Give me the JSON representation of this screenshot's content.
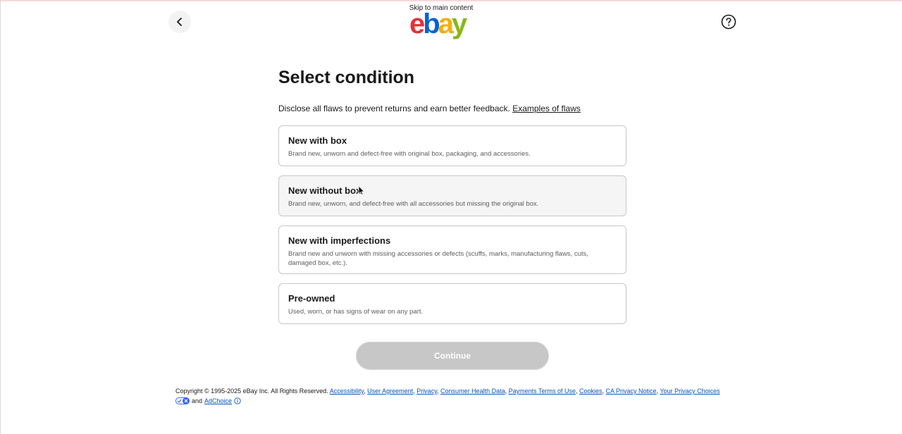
{
  "header": {
    "skip_link": "Skip to main content",
    "logo": {
      "e": "e",
      "b": "b",
      "a": "a",
      "y": "y"
    },
    "colors": {
      "e": "#e53238",
      "b": "#0064d2",
      "a": "#f5af02",
      "y": "#86b817"
    },
    "back_icon": "chevron-left-icon",
    "help_icon": "question-circle-icon"
  },
  "main": {
    "title": "Select condition",
    "subtitle": "Disclose all flaws to prevent returns and earn better feedback.",
    "examples_link": "Examples of flaws",
    "options": [
      {
        "title": "New with box",
        "desc": "Brand new, unworn and defect-free with original box, packaging, and accessories."
      },
      {
        "title": "New without box",
        "desc": "Brand new, unworn, and defect-free with all accessories but missing the original box."
      },
      {
        "title": "New with imperfections",
        "desc": "Brand new and unworn with missing accessories or defects (scuffs, marks, manufacturing flaws, cuts, damaged box, etc.)."
      },
      {
        "title": "Pre-owned",
        "desc": "Used, worn, or has signs of wear on any part."
      }
    ],
    "continue_label": "Continue"
  },
  "footer": {
    "copyright": "Copyright © 1995-2025 eBay Inc. All Rights Reserved.",
    "links": [
      "Accessibility",
      "User Agreement",
      "Privacy",
      "Consumer Health Data",
      "Payments Terms of Use",
      "Cookies",
      "CA Privacy Notice",
      "Your Privacy Choices"
    ],
    "and_text": "and",
    "adchoice": "AdChoice"
  }
}
